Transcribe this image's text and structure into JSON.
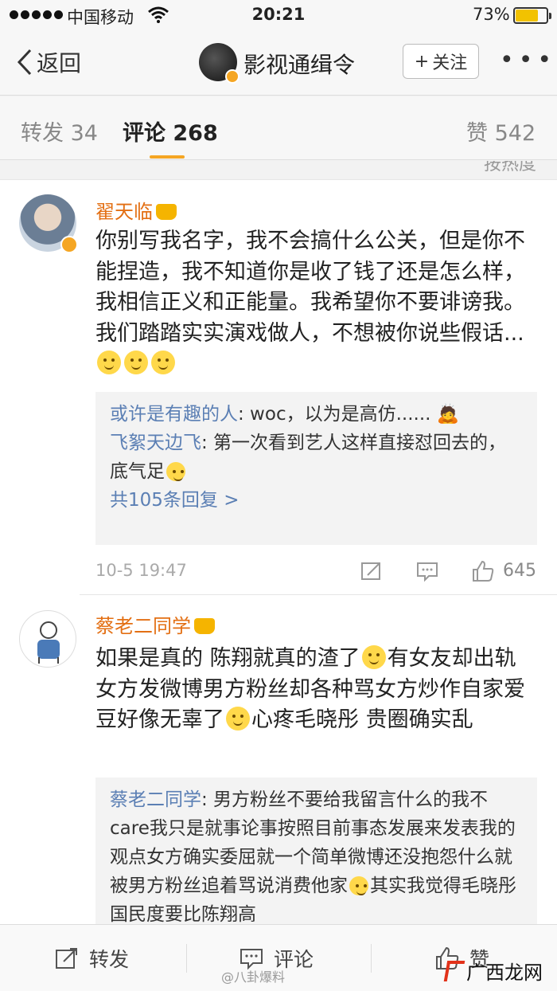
{
  "status_bar": {
    "carrier": "中国移动",
    "time": "20:21",
    "battery": "73%",
    "battery_level": 0.73
  },
  "nav": {
    "back_label": "返回",
    "title": "影视通缉令",
    "follow_label": "关注",
    "more": "•••"
  },
  "tabs": [
    {
      "label": "转发 34"
    },
    {
      "label": "评论 268"
    },
    {
      "label": "赞 542"
    }
  ],
  "cut_text": "按热度",
  "comments": [
    {
      "name": "翟天临",
      "body": "你别写我名字，我不会搞什么公关，但是你不能捏造，我不知道你是收了钱了还是怎么样，我相信正义和正能量。我希望你不要诽谤我。我们踏踏实实演戏做人，不想被你说些假话...",
      "replies": [
        {
          "who": "或许是有趣的人",
          "text": ": woc，以为是高仿......"
        },
        {
          "who": "飞絮天边飞",
          "text": ": 第一次看到艺人这样直接怼回去的，底气足"
        }
      ],
      "more_replies": "共105条回复 >",
      "time": "10-5 19:47",
      "likes": "645"
    },
    {
      "name": "蔡老二同学",
      "body_parts": [
        "如果是真的   陈翔就真的渣了",
        "有女友却出轨   女方发微博男方粉丝却各种骂女方炒作自家爱豆好像无辜了",
        "心疼毛晓彤    贵圈确实乱"
      ],
      "replies": [
        {
          "who": "蔡老二同学",
          "text": ": 男方粉丝不要给我留言什么的我不care我只是就事论事按照目前事态发展来发表我的观点女方确实委屈就一个简单微博还没抱怨什么就被男方粉丝追着骂说消费他家"
        },
        {
          "who": "",
          "text": "其实我觉得毛晓彤国民度要比陈翔高"
        }
      ]
    }
  ],
  "toolbar": {
    "repost": "转发",
    "comment": "评论",
    "like": "赞"
  },
  "watermark": "@八卦爆料",
  "site_logo": "广西龙网"
}
